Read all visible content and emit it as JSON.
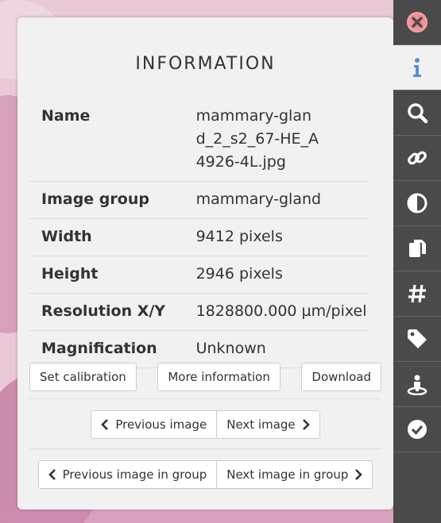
{
  "panel": {
    "title": "INFORMATION",
    "rows": [
      {
        "label": "Name",
        "value": "mammary-gland_2_s2_67-HE_A4926-4L.jpg"
      },
      {
        "label": "Image group",
        "value": "mammary-gland"
      },
      {
        "label": "Width",
        "value": "9412 pixels"
      },
      {
        "label": "Height",
        "value": "2946 pixels"
      },
      {
        "label": "Resolution X/Y",
        "value": "1828800.000 µm/pixel"
      },
      {
        "label": "Magnification",
        "value": "Unknown"
      }
    ],
    "buttons": {
      "set_calibration": "Set calibration",
      "more_information": "More information",
      "download": "Download",
      "previous_image": "Previous image",
      "next_image": "Next image",
      "previous_image_in_group": "Previous image in group",
      "next_image_in_group": "Next image in group"
    }
  },
  "sidebar": {
    "items": [
      {
        "icon": "close-icon"
      },
      {
        "icon": "info-icon",
        "active": true
      },
      {
        "icon": "search-icon"
      },
      {
        "icon": "link-icon"
      },
      {
        "icon": "contrast-icon"
      },
      {
        "icon": "copy-icon"
      },
      {
        "icon": "hashtag-icon"
      },
      {
        "icon": "tag-icon"
      },
      {
        "icon": "annotation-icon"
      },
      {
        "icon": "check-icon"
      }
    ]
  },
  "colors": {
    "sidebar": "#4a4a4a",
    "panel": "#f1f1f1",
    "close_accent": "#e8505b",
    "info_accent": "#5b8bd9"
  }
}
